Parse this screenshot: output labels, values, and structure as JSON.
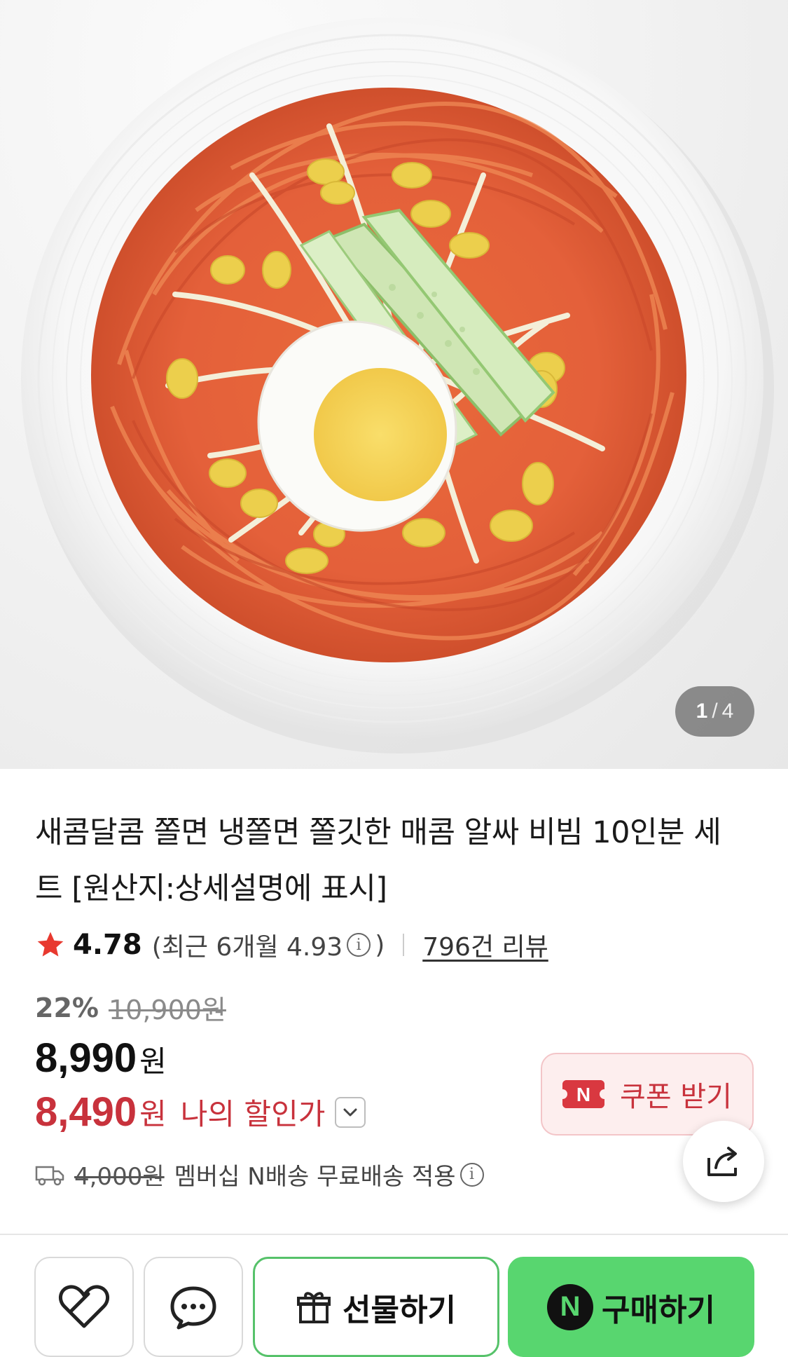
{
  "gallery": {
    "image_alt": "bibim noodles on white plate",
    "current": "1",
    "separator": "/",
    "total": "4"
  },
  "product": {
    "title": "새콤달콤 쫄면 냉쫄면 쫄깃한 매콤 알싸 비빔 10인분 세트 [원산지:상세설명에 표시]",
    "rating": "4.78",
    "recent_rating_text": "(최근 6개월 4.93",
    "recent_rating_close": ")",
    "review_count": "796건 리뷰",
    "discount_rate": "22%",
    "original_price": "10,900원",
    "price": "8,990",
    "price_unit": "원",
    "my_price": "8,490",
    "my_price_unit": "원",
    "my_price_label": "나의 할인가"
  },
  "coupon": {
    "badge": "N",
    "label": "쿠폰 받기"
  },
  "shipping": {
    "original_fee": "4,000원",
    "text": "멤버십 N배송 무료배송 적용"
  },
  "actions": {
    "gift_label": "선물하기",
    "buy_label": "구매하기",
    "npay_badge": "N"
  },
  "colors": {
    "accent_red": "#c8323c",
    "buy_green": "#58d66f",
    "star_red": "#e8392f"
  }
}
